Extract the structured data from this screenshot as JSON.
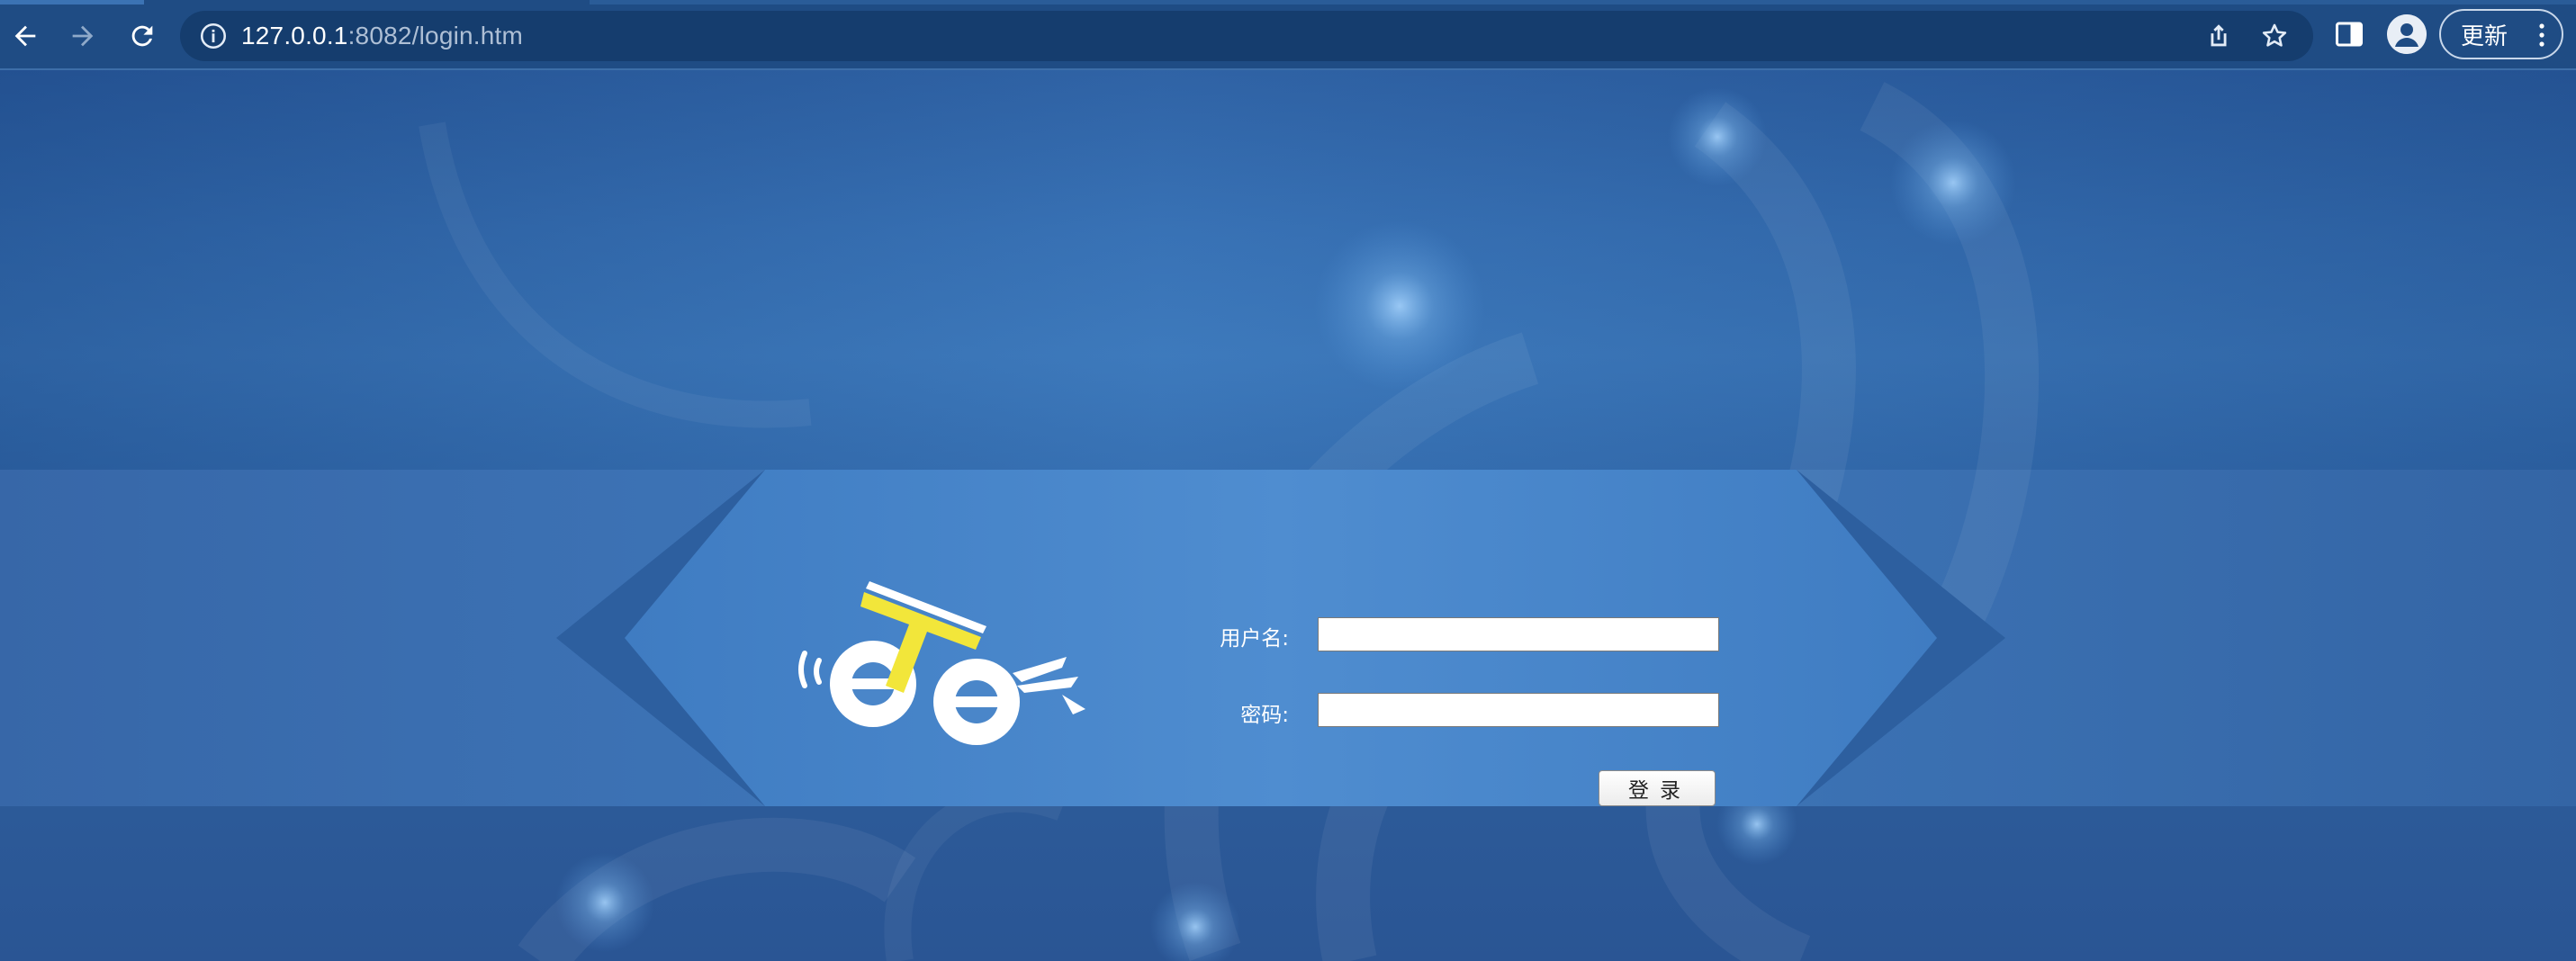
{
  "browser": {
    "url_host": "127.0.0.1",
    "url_rest": ":8082/login.htm",
    "update_label": "更新",
    "icons": [
      "back-arrow-icon",
      "forward-arrow-icon",
      "reload-icon",
      "info-icon",
      "share-icon",
      "bookmark-star-icon",
      "side-panel-icon",
      "profile-avatar-icon",
      "menu-dots-icon"
    ]
  },
  "login": {
    "username_label": "用户名:",
    "password_label": "密码:",
    "username_value": "",
    "password_value": "",
    "submit_label": "登录"
  },
  "colors": {
    "toolbar": "#1f4c84",
    "omnibox": "#153d6e",
    "page_bg": "#3b76b8",
    "logo_yellow": "#f2e63a"
  }
}
